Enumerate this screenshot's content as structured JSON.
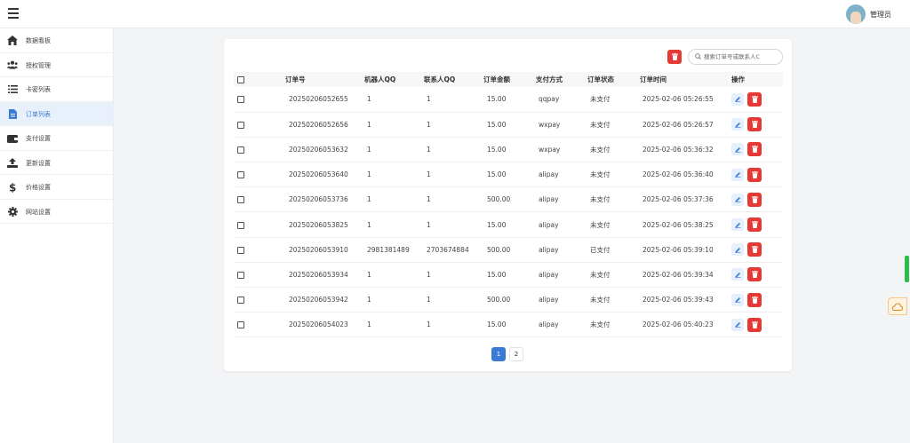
{
  "header": {
    "admin_name": "管理员"
  },
  "sidebar": {
    "items": [
      {
        "label": "数据看板",
        "icon": "home-icon",
        "active": false
      },
      {
        "label": "授权管理",
        "icon": "users-icon",
        "active": false
      },
      {
        "label": "卡密列表",
        "icon": "list-icon",
        "active": false
      },
      {
        "label": "订单列表",
        "icon": "file-icon",
        "active": true
      },
      {
        "label": "支付设置",
        "icon": "wallet-icon",
        "active": false
      },
      {
        "label": "更新设置",
        "icon": "upload-icon",
        "active": false
      },
      {
        "label": "价格设置",
        "icon": "dollar-icon",
        "active": false
      },
      {
        "label": "网站设置",
        "icon": "gear-icon",
        "active": false
      }
    ]
  },
  "search": {
    "placeholder": "搜索订单号或联系人C"
  },
  "table": {
    "headers": [
      "订单号",
      "机器人QQ",
      "联系人QQ",
      "订单金额",
      "支付方式",
      "订单状态",
      "订单时间",
      "操作"
    ],
    "rows": [
      [
        "20250206052655",
        "1",
        "1",
        "15.00",
        "qqpay",
        "未支付",
        "2025-02-06 05:26:55"
      ],
      [
        "20250206052656",
        "1",
        "1",
        "15.00",
        "wxpay",
        "未支付",
        "2025-02-06 05:26:57"
      ],
      [
        "20250206053632",
        "1",
        "1",
        "15.00",
        "wxpay",
        "未支付",
        "2025-02-06 05:36:32"
      ],
      [
        "20250206053640",
        "1",
        "1",
        "15.00",
        "alipay",
        "未支付",
        "2025-02-06 05:36:40"
      ],
      [
        "20250206053736",
        "1",
        "1",
        "500.00",
        "alipay",
        "未支付",
        "2025-02-06 05:37:36"
      ],
      [
        "20250206053825",
        "1",
        "1",
        "15.00",
        "alipay",
        "未支付",
        "2025-02-06 05:38:25"
      ],
      [
        "20250206053910",
        "2981381489",
        "2703674884",
        "500.00",
        "alipay",
        "已支付",
        "2025-02-06 05:39:10"
      ],
      [
        "20250206053934",
        "1",
        "1",
        "15.00",
        "alipay",
        "未支付",
        "2025-02-06 05:39:34"
      ],
      [
        "20250206053942",
        "1",
        "1",
        "500.00",
        "alipay",
        "未支付",
        "2025-02-06 05:39:43"
      ],
      [
        "20250206054023",
        "1",
        "1",
        "15.00",
        "alipay",
        "未支付",
        "2025-02-06 05:40:23"
      ]
    ]
  },
  "pagination": {
    "pages": [
      "1",
      "2"
    ],
    "current": "1"
  },
  "colors": {
    "accent": "#3a7bd5",
    "danger": "#e53935",
    "scroll": "#2dbb4e"
  }
}
